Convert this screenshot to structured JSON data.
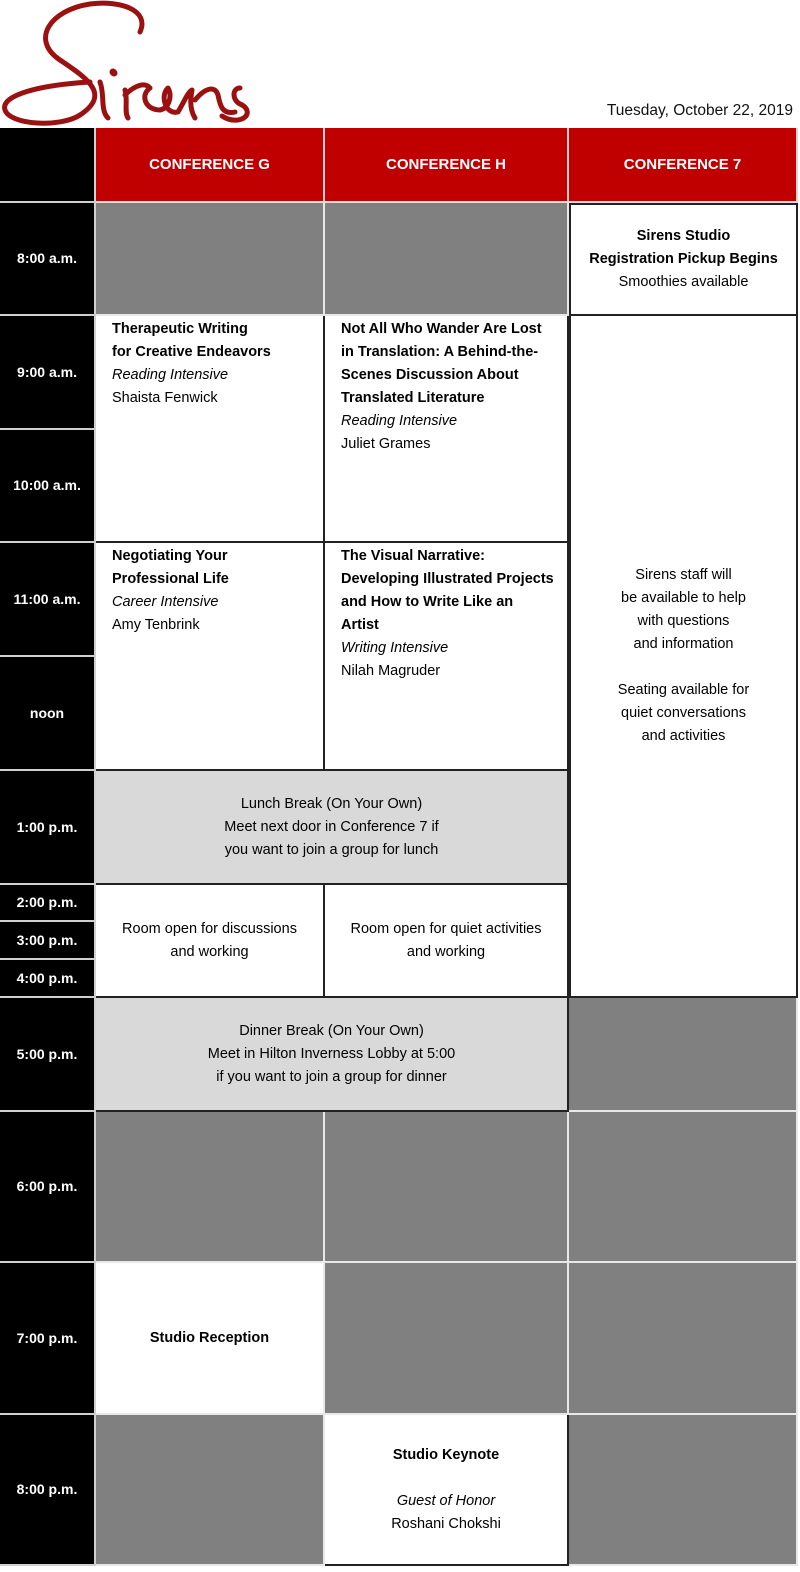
{
  "header": {
    "logo_text": "Sirens",
    "date": "Tuesday, October 22, 2019",
    "brand_color": "#c00000",
    "logo_color": "#9b1010"
  },
  "columns": [
    "CONFERENCE G",
    "CONFERENCE H",
    "CONFERENCE 7"
  ],
  "times": [
    "8:00 a.m.",
    "9:00 a.m.",
    "10:00 a.m.",
    "11:00 a.m.",
    "noon",
    "1:00 p.m.",
    "2:00 p.m.",
    "3:00 p.m.",
    "4:00 p.m.",
    "5:00 p.m.",
    "6:00 p.m.",
    "7:00 p.m.",
    "8:00 p.m."
  ],
  "events": {
    "registration": {
      "title1": "Sirens Studio",
      "title2": "Registration Pickup Begins",
      "note": "Smoothies available"
    },
    "therapeutic": {
      "title1": "Therapeutic Writing",
      "title2": "for Creative Endeavors",
      "track": "Reading Intensive",
      "presenter": "Shaista Fenwick"
    },
    "translation": {
      "title1": "Not All Who Wander Are Lost",
      "title2": "in Translation: A Behind-the-",
      "title3": "Scenes Discussion About",
      "title4": "Translated Literature",
      "track": "Reading Intensive",
      "presenter": "Juliet Grames"
    },
    "negotiating": {
      "title1": "Negotiating Your",
      "title2": "Professional Life",
      "track": "Career Intensive",
      "presenter": "Amy Tenbrink"
    },
    "visual": {
      "title1": "The Visual Narrative:",
      "title2": "Developing Illustrated Projects",
      "title3": "and How to Write Like an",
      "title4": "Artist",
      "track": "Writing Intensive",
      "presenter": "Nilah Magruder"
    },
    "staff": {
      "line1": "Sirens staff will",
      "line2": "be available to help",
      "line3": "with questions",
      "line4": "and information",
      "line5": "Seating available for",
      "line6": "quiet conversations",
      "line7": "and activities"
    },
    "lunch": {
      "line1": "Lunch Break (On Your Own)",
      "line2": "Meet next door in Conference 7 if",
      "line3": "you want to join a group for lunch"
    },
    "room_g": {
      "line1": "Room open for discussions",
      "line2": "and working"
    },
    "room_h": {
      "line1": "Room open for quiet activities",
      "line2": "and working"
    },
    "dinner": {
      "line1": "Dinner Break (On Your Own)",
      "line2": "Meet in Hilton Inverness Lobby at 5:00",
      "line3": "if you want to join a group for dinner"
    },
    "reception": {
      "title": "Studio Reception"
    },
    "keynote": {
      "title": "Studio Keynote",
      "role": "Guest of Honor",
      "speaker": "Roshani Chokshi"
    }
  }
}
